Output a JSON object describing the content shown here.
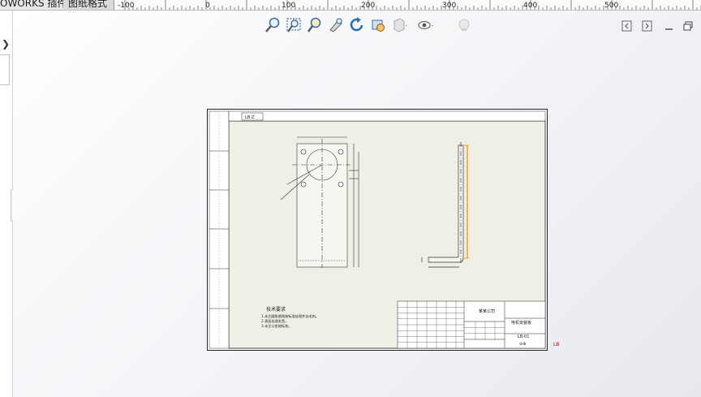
{
  "tabs": {
    "addins": "OWORKS 插件",
    "sheet_format": "图纸格式"
  },
  "ruler": {
    "ticks": [
      "-100",
      "0",
      "100",
      "200",
      "300",
      "400",
      "500"
    ]
  },
  "hud": {
    "buttons": [
      "zoom-to-fit-icon",
      "zoom-to-area-icon",
      "zoom-in-out-icon",
      "zoom-selection-icon",
      "rotate-icon",
      "pan-icon",
      "display-style-icon",
      "hide-show-icon",
      "appearance-icon"
    ]
  },
  "drawing": {
    "view_tag": "LB-Z",
    "notes": {
      "title": "技术要求",
      "lines": [
        "1.未注圆角倒角按标准处理并去毛刺。",
        "2.表面处理发黑。",
        "3.未注公差按标准。"
      ]
    },
    "title_block": {
      "company": "某某公司",
      "part_name": "电机安装板",
      "drawing_no": "LB-01"
    },
    "corner_mark": "LB"
  },
  "colors": {
    "selection": "#ff8c00",
    "sheet_bg": "#efefe6",
    "accent_icon": "#2f6fb0"
  }
}
